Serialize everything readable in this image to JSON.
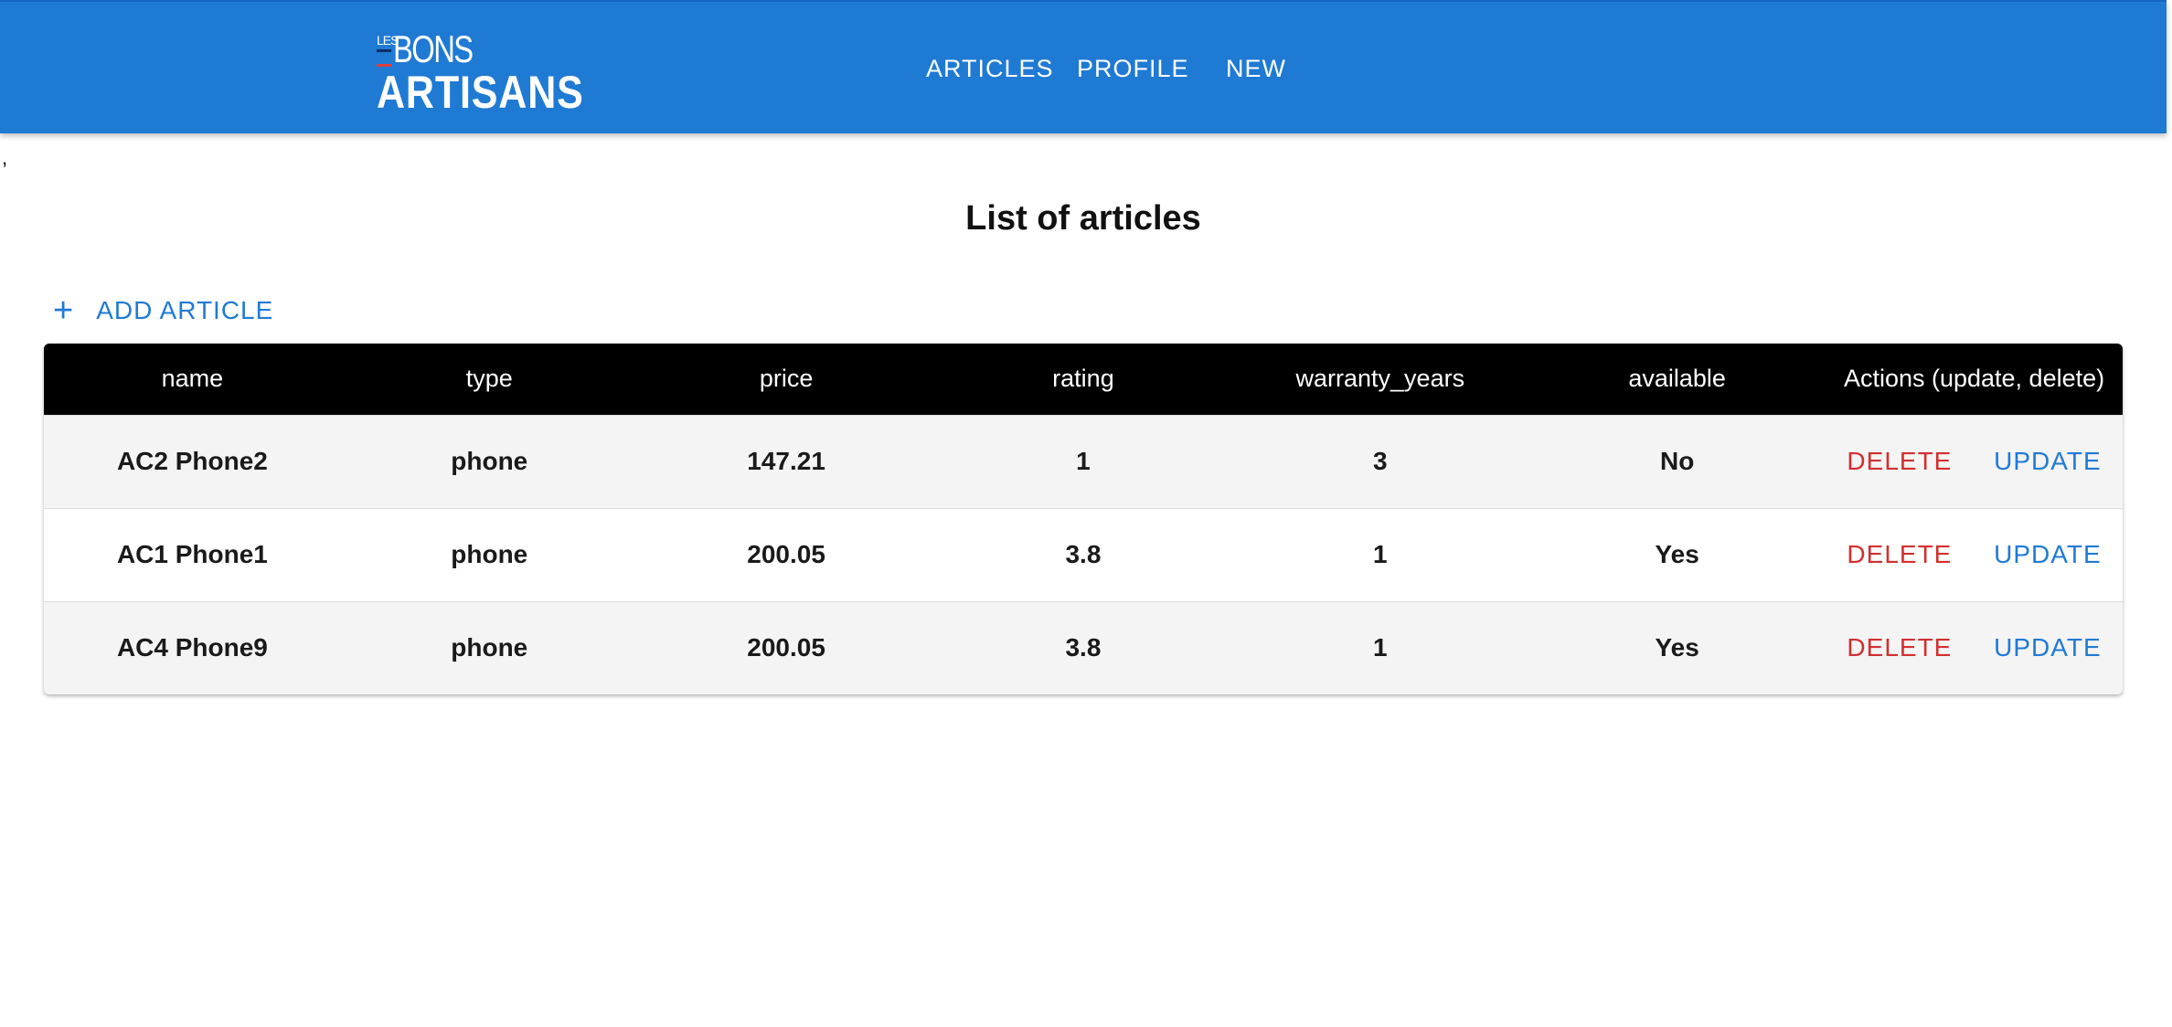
{
  "header": {
    "logo": {
      "top_text": "LES",
      "line1": "BONS",
      "line2": "ARTISANS"
    },
    "nav": [
      {
        "label": "ARTICLES"
      },
      {
        "label": "PROFILE"
      },
      {
        "label": "NEW"
      }
    ],
    "background_color": "#1f7ad4"
  },
  "stray_mark": ",",
  "main": {
    "title": "List of articles",
    "add_button_icon": "plus-icon",
    "add_button_label": "ADD ARTICLE"
  },
  "table": {
    "headers": [
      "name",
      "type",
      "price",
      "rating",
      "warranty_years",
      "available",
      "Actions (update, delete)"
    ],
    "rows": [
      {
        "name": "AC2 Phone2",
        "type": "phone",
        "price": "147.21",
        "rating": "1",
        "warranty_years": "3",
        "available": "No",
        "delete_label": "DELETE",
        "update_label": "UPDATE"
      },
      {
        "name": "AC1 Phone1",
        "type": "phone",
        "price": "200.05",
        "rating": "3.8",
        "warranty_years": "1",
        "available": "Yes",
        "delete_label": "DELETE",
        "update_label": "UPDATE"
      },
      {
        "name": "AC4 Phone9",
        "type": "phone",
        "price": "200.05",
        "rating": "3.8",
        "warranty_years": "1",
        "available": "Yes",
        "delete_label": "DELETE",
        "update_label": "UPDATE"
      }
    ],
    "header_color": "#000000",
    "delete_color": "#d32f2f",
    "update_color": "#1f7ad4"
  }
}
